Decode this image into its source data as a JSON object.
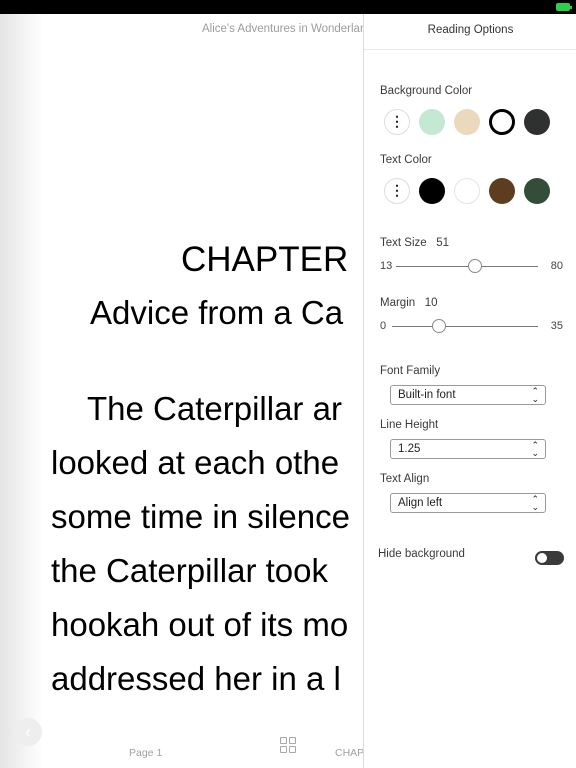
{
  "status_bar": {
    "battery_icon": "battery-icon",
    "battery_color": "#2bd14b"
  },
  "reader": {
    "book_title": "Alice's Adventures in Wonderlan",
    "chapter_title": "CHAPTER",
    "chapter_subtitle": "Advice from a Ca",
    "paragraph_lines": [
      "The Caterpillar ar",
      "looked at each othe",
      "some time in silence",
      "the Caterpillar took",
      "hookah out of its mo",
      "addressed her in a l"
    ],
    "footer": {
      "prev_icon": "chevron-left-icon",
      "page_label": "Page 1",
      "grid_icon": "grid-icon",
      "chapter_label": "CHAP"
    }
  },
  "panel": {
    "title": "Reading Options",
    "background_color": {
      "label": "Background Color",
      "more_icon": "more-vertical-icon",
      "swatches": [
        "#c4e8d2",
        "#ead9bd",
        "#ffffff",
        "#2f3030"
      ],
      "selected": "#ffffff"
    },
    "text_color": {
      "label": "Text Color",
      "more_icon": "more-vertical-icon",
      "swatches": [
        "#000000",
        "#ffffff",
        "#5c3d1f",
        "#344d3a"
      ]
    },
    "text_size": {
      "label": "Text Size",
      "value": "51",
      "min": "13",
      "max": "80"
    },
    "margin": {
      "label": "Margin",
      "value": "10",
      "min": "0",
      "max": "35"
    },
    "font_family": {
      "label": "Font Family",
      "value": "Built-in font"
    },
    "line_height": {
      "label": "Line Height",
      "value": "1.25"
    },
    "text_align": {
      "label": "Text Align",
      "value": "Align left"
    },
    "hide_background": {
      "label": "Hide background",
      "enabled": false
    }
  }
}
